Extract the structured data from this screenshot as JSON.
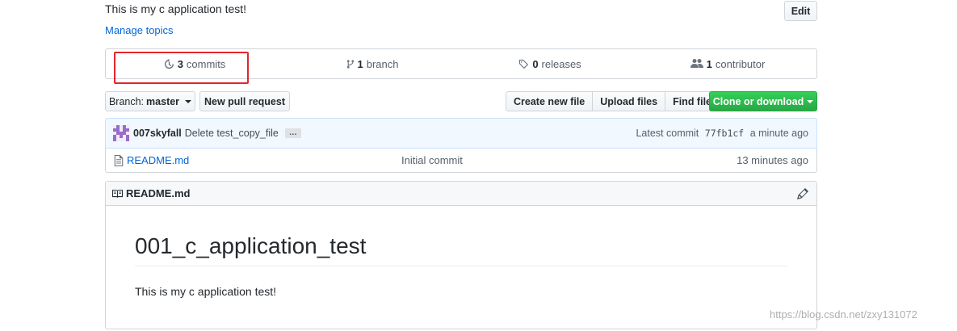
{
  "repo": {
    "description": "This is my c application test!",
    "manage_topics": "Manage topics",
    "edit_label": "Edit"
  },
  "numbers": {
    "commits_count": "3",
    "commits_label": "commits",
    "branch_count": "1",
    "branch_label": "branch",
    "releases_count": "0",
    "releases_label": "releases",
    "contributor_count": "1",
    "contributor_label": "contributor"
  },
  "toolbar": {
    "branch_prefix": "Branch:",
    "branch_name": "master",
    "new_pr": "New pull request",
    "create_file": "Create new file",
    "upload_files": "Upload files",
    "find_file": "Find file",
    "clone": "Clone or download"
  },
  "commit_tease": {
    "author": "007skyfall",
    "message": "Delete test_copy_file",
    "ellipsis": "…",
    "latest_label": "Latest commit",
    "sha": "77fb1cf",
    "age": "a minute ago"
  },
  "files": [
    {
      "name": "README.md",
      "commit": "Initial commit",
      "age": "13 minutes ago"
    }
  ],
  "readme": {
    "title": "README.md",
    "heading": "001_c_application_test",
    "body": "This is my c application test!"
  },
  "watermark": "https://blog.csdn.net/zxy131072",
  "colors": {
    "highlight": "#e5262a",
    "clone_green": "#28a745",
    "link_blue": "#0366d6"
  }
}
